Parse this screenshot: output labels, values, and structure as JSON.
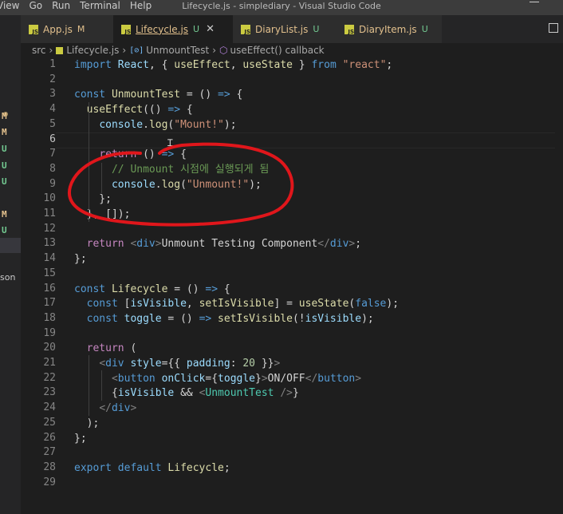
{
  "titlebar": {
    "menu": [
      "View",
      "Go",
      "Run",
      "Terminal",
      "Help"
    ],
    "window_title": "Lifecycle.js - simplediary - Visual Studio Code"
  },
  "sidebar": {
    "badges": [
      "M",
      "M",
      "U",
      "U",
      "U",
      "M",
      "U"
    ],
    "partial_text": "son"
  },
  "tabs": [
    {
      "name": "App.js",
      "status": "M",
      "active": false
    },
    {
      "name": "Lifecycle.js",
      "status": "U",
      "active": true
    },
    {
      "name": "DiaryList.js",
      "status": "U",
      "active": false
    },
    {
      "name": "DiaryItem.js",
      "status": "U",
      "active": false
    }
  ],
  "breadcrumb": {
    "folder": "src",
    "file": "Lifecycle.js",
    "symbol": "UnmountTest",
    "callback": "useEffect() callback",
    "symbol_icon": "[⊘]"
  },
  "editor": {
    "current_line": 6,
    "line_numbers": [
      1,
      2,
      3,
      4,
      5,
      6,
      7,
      8,
      9,
      10,
      11,
      12,
      13,
      14,
      15,
      16,
      17,
      18,
      19,
      20,
      21,
      22,
      23,
      24,
      25,
      26,
      27,
      28,
      29
    ],
    "lines": [
      "import React, { useEffect, useState } from \"react\";",
      "",
      "const UnmountTest = () => {",
      "  useEffect(() => {",
      "    console.log(\"Mount!\");",
      "",
      "    return () => {",
      "      // Unmount 시점에 실행되게 됨",
      "      console.log(\"Unmount!\");",
      "    };",
      "  }, []);",
      "",
      "  return <div>Unmount Testing Component</div>;",
      "};",
      "",
      "const Lifecycle = () => {",
      "  const [isVisible, setIsVisible] = useState(false);",
      "  const toggle = () => setIsVisible(!isVisible);",
      "",
      "  return (",
      "    <div style={{ padding: 20 }}>",
      "      <button onClick={toggle}>ON/OFF</button>",
      "      {isVisible && <UnmountTest />}",
      "    </div>",
      "  );",
      "};",
      "",
      "export default Lifecycle;",
      ""
    ]
  },
  "annotation": {
    "color": "#e0161b",
    "shape": "red-hand-drawn-ellipse"
  }
}
